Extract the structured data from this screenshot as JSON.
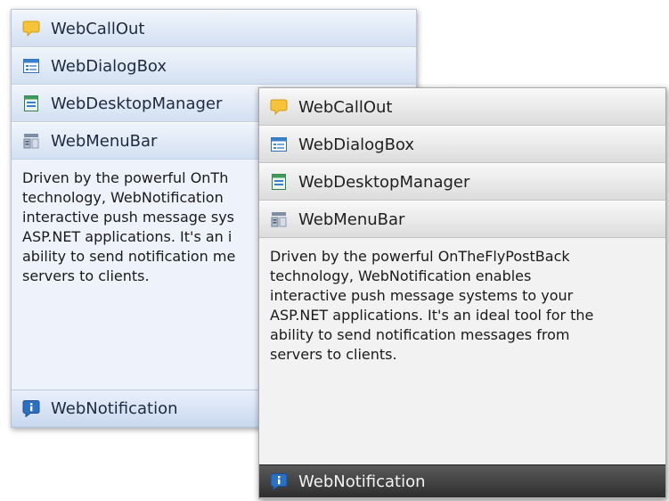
{
  "panels": [
    {
      "theme": "blue",
      "items": [
        {
          "label": "WebCallOut",
          "icon": "callout-icon"
        },
        {
          "label": "WebDialogBox",
          "icon": "dialog-box-icon"
        },
        {
          "label": "WebDesktopManager",
          "icon": "desktop-manager-icon"
        },
        {
          "label": "WebMenuBar",
          "icon": "menu-bar-icon"
        }
      ],
      "description": "Driven by the powerful OnTh\ntechnology, WebNotification \ninteractive push message sys\nASP.NET applications. It's an i\nability to send notification me\nservers to clients.",
      "active_item": {
        "label": "WebNotification",
        "icon": "notification-icon"
      }
    },
    {
      "theme": "gray",
      "items": [
        {
          "label": "WebCallOut",
          "icon": "callout-icon"
        },
        {
          "label": "WebDialogBox",
          "icon": "dialog-box-icon"
        },
        {
          "label": "WebDesktopManager",
          "icon": "desktop-manager-icon"
        },
        {
          "label": "WebMenuBar",
          "icon": "menu-bar-icon"
        }
      ],
      "description": "Driven by the powerful OnTheFlyPostBack\ntechnology, WebNotification enables\ninteractive push message systems to your\nASP.NET applications. It's an ideal tool for the\nability to send notification messages from\nservers to clients.",
      "active_item": {
        "label": "WebNotification",
        "icon": "notification-icon"
      }
    }
  ],
  "colors": {
    "blue_header": "#d3e0f1",
    "gray_header": "#dcdcdc",
    "gray_active": "#2e2e2e"
  }
}
